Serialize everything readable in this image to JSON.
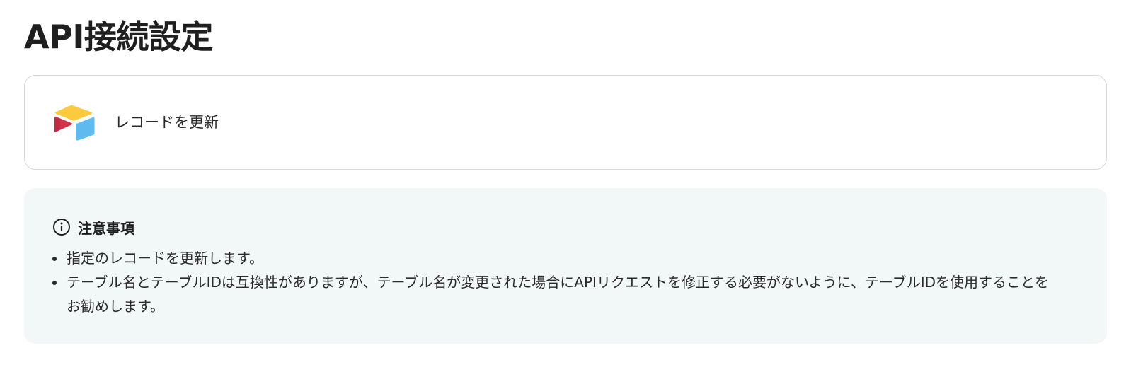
{
  "page": {
    "title": "API接続設定"
  },
  "action": {
    "app_icon": "airtable-logo-icon",
    "label": "レコードを更新"
  },
  "notice": {
    "icon": "info-circle-icon",
    "title": "注意事項",
    "items": [
      "指定のレコードを更新します。",
      "テーブル名とテーブルIDは互換性がありますが、テーブル名が変更された場合にAPIリクエストを修正する必要がないように、テーブルIDを使用することをお勧めします。"
    ]
  },
  "colors": {
    "notice_background": "#f2f7f7",
    "card_border": "#d6d6d6",
    "logo_yellow": "#fcca3f",
    "logo_blue": "#5fbbef",
    "logo_red": "#d4324a"
  }
}
